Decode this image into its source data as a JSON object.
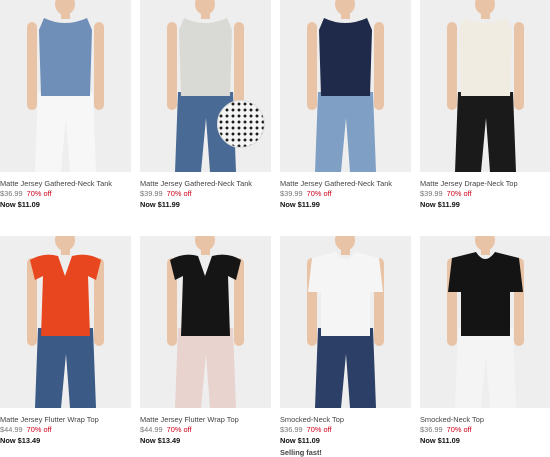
{
  "products": [
    {
      "name": "Matte Jersey Gathered-Neck Tank",
      "orig_price": "$36.99",
      "discount": "70% off",
      "now_price": "Now $11.09",
      "flag": "",
      "top_color": "#6f8fb8",
      "bottom_color": "#f7f7f7",
      "style": "tank"
    },
    {
      "name": "Matte Jersey Gathered-Neck Tank",
      "orig_price": "$39.99",
      "discount": "70% off",
      "now_price": "Now $11.99",
      "flag": "",
      "top_color": "#d9d9d5",
      "bottom_color": "#4a6a96",
      "style": "tank"
    },
    {
      "name": "Matte Jersey Gathered-Neck Tank",
      "orig_price": "$39.99",
      "discount": "70% off",
      "now_price": "Now $11.99",
      "flag": "",
      "top_color": "#1f2a4a",
      "bottom_color": "#7fa0c4",
      "style": "tank"
    },
    {
      "name": "Matte Jersey Drape-Neck Top",
      "orig_price": "$39.99",
      "discount": "70% off",
      "now_price": "Now $11.99",
      "flag": "",
      "top_color": "#f1ece1",
      "bottom_color": "#1a1a1a",
      "style": "tank"
    },
    {
      "name": "Matte Jersey Flutter Wrap Top",
      "orig_price": "$44.99",
      "discount": "70% off",
      "now_price": "Now $13.49",
      "flag": "",
      "top_color": "#e8461f",
      "bottom_color": "#3b5a86",
      "style": "flutter"
    },
    {
      "name": "Matte Jersey Flutter Wrap Top",
      "orig_price": "$44.99",
      "discount": "70% off",
      "now_price": "Now $13.49",
      "flag": "",
      "top_color": "#151515",
      "bottom_color": "#e8d3cf",
      "style": "flutter"
    },
    {
      "name": "Smocked-Neck Top",
      "orig_price": "$36.99",
      "discount": "70% off",
      "now_price": "Now $11.09",
      "flag": "Selling fast!",
      "top_color": "#f5f5f5",
      "bottom_color": "#2c3f66",
      "style": "tee"
    },
    {
      "name": "Smocked-Neck Top",
      "orig_price": "$36.99",
      "discount": "70% off",
      "now_price": "Now $11.09",
      "flag": "",
      "top_color": "#141414",
      "bottom_color": "#f4f4f4",
      "style": "tee"
    }
  ],
  "colors": {
    "skin": "#e9c3a6",
    "hair": "#3a2a22",
    "photo_bg": "#eeeeee",
    "sale_red": "#d0021b"
  }
}
